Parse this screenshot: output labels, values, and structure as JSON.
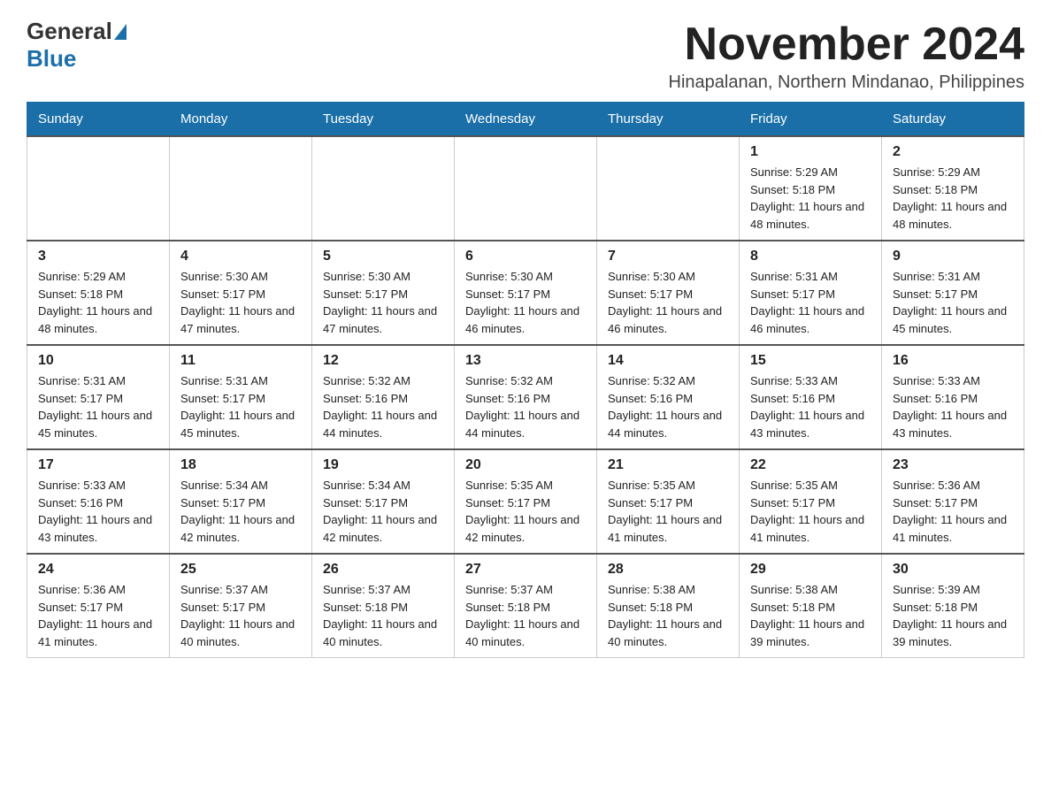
{
  "logo": {
    "general": "General",
    "blue": "Blue"
  },
  "title": "November 2024",
  "location": "Hinapalanan, Northern Mindanao, Philippines",
  "weekdays": [
    "Sunday",
    "Monday",
    "Tuesday",
    "Wednesday",
    "Thursday",
    "Friday",
    "Saturday"
  ],
  "weeks": [
    [
      {
        "day": "",
        "info": ""
      },
      {
        "day": "",
        "info": ""
      },
      {
        "day": "",
        "info": ""
      },
      {
        "day": "",
        "info": ""
      },
      {
        "day": "",
        "info": ""
      },
      {
        "day": "1",
        "info": "Sunrise: 5:29 AM\nSunset: 5:18 PM\nDaylight: 11 hours and 48 minutes."
      },
      {
        "day": "2",
        "info": "Sunrise: 5:29 AM\nSunset: 5:18 PM\nDaylight: 11 hours and 48 minutes."
      }
    ],
    [
      {
        "day": "3",
        "info": "Sunrise: 5:29 AM\nSunset: 5:18 PM\nDaylight: 11 hours and 48 minutes."
      },
      {
        "day": "4",
        "info": "Sunrise: 5:30 AM\nSunset: 5:17 PM\nDaylight: 11 hours and 47 minutes."
      },
      {
        "day": "5",
        "info": "Sunrise: 5:30 AM\nSunset: 5:17 PM\nDaylight: 11 hours and 47 minutes."
      },
      {
        "day": "6",
        "info": "Sunrise: 5:30 AM\nSunset: 5:17 PM\nDaylight: 11 hours and 46 minutes."
      },
      {
        "day": "7",
        "info": "Sunrise: 5:30 AM\nSunset: 5:17 PM\nDaylight: 11 hours and 46 minutes."
      },
      {
        "day": "8",
        "info": "Sunrise: 5:31 AM\nSunset: 5:17 PM\nDaylight: 11 hours and 46 minutes."
      },
      {
        "day": "9",
        "info": "Sunrise: 5:31 AM\nSunset: 5:17 PM\nDaylight: 11 hours and 45 minutes."
      }
    ],
    [
      {
        "day": "10",
        "info": "Sunrise: 5:31 AM\nSunset: 5:17 PM\nDaylight: 11 hours and 45 minutes."
      },
      {
        "day": "11",
        "info": "Sunrise: 5:31 AM\nSunset: 5:17 PM\nDaylight: 11 hours and 45 minutes."
      },
      {
        "day": "12",
        "info": "Sunrise: 5:32 AM\nSunset: 5:16 PM\nDaylight: 11 hours and 44 minutes."
      },
      {
        "day": "13",
        "info": "Sunrise: 5:32 AM\nSunset: 5:16 PM\nDaylight: 11 hours and 44 minutes."
      },
      {
        "day": "14",
        "info": "Sunrise: 5:32 AM\nSunset: 5:16 PM\nDaylight: 11 hours and 44 minutes."
      },
      {
        "day": "15",
        "info": "Sunrise: 5:33 AM\nSunset: 5:16 PM\nDaylight: 11 hours and 43 minutes."
      },
      {
        "day": "16",
        "info": "Sunrise: 5:33 AM\nSunset: 5:16 PM\nDaylight: 11 hours and 43 minutes."
      }
    ],
    [
      {
        "day": "17",
        "info": "Sunrise: 5:33 AM\nSunset: 5:16 PM\nDaylight: 11 hours and 43 minutes."
      },
      {
        "day": "18",
        "info": "Sunrise: 5:34 AM\nSunset: 5:17 PM\nDaylight: 11 hours and 42 minutes."
      },
      {
        "day": "19",
        "info": "Sunrise: 5:34 AM\nSunset: 5:17 PM\nDaylight: 11 hours and 42 minutes."
      },
      {
        "day": "20",
        "info": "Sunrise: 5:35 AM\nSunset: 5:17 PM\nDaylight: 11 hours and 42 minutes."
      },
      {
        "day": "21",
        "info": "Sunrise: 5:35 AM\nSunset: 5:17 PM\nDaylight: 11 hours and 41 minutes."
      },
      {
        "day": "22",
        "info": "Sunrise: 5:35 AM\nSunset: 5:17 PM\nDaylight: 11 hours and 41 minutes."
      },
      {
        "day": "23",
        "info": "Sunrise: 5:36 AM\nSunset: 5:17 PM\nDaylight: 11 hours and 41 minutes."
      }
    ],
    [
      {
        "day": "24",
        "info": "Sunrise: 5:36 AM\nSunset: 5:17 PM\nDaylight: 11 hours and 41 minutes."
      },
      {
        "day": "25",
        "info": "Sunrise: 5:37 AM\nSunset: 5:17 PM\nDaylight: 11 hours and 40 minutes."
      },
      {
        "day": "26",
        "info": "Sunrise: 5:37 AM\nSunset: 5:18 PM\nDaylight: 11 hours and 40 minutes."
      },
      {
        "day": "27",
        "info": "Sunrise: 5:37 AM\nSunset: 5:18 PM\nDaylight: 11 hours and 40 minutes."
      },
      {
        "day": "28",
        "info": "Sunrise: 5:38 AM\nSunset: 5:18 PM\nDaylight: 11 hours and 40 minutes."
      },
      {
        "day": "29",
        "info": "Sunrise: 5:38 AM\nSunset: 5:18 PM\nDaylight: 11 hours and 39 minutes."
      },
      {
        "day": "30",
        "info": "Sunrise: 5:39 AM\nSunset: 5:18 PM\nDaylight: 11 hours and 39 minutes."
      }
    ]
  ]
}
